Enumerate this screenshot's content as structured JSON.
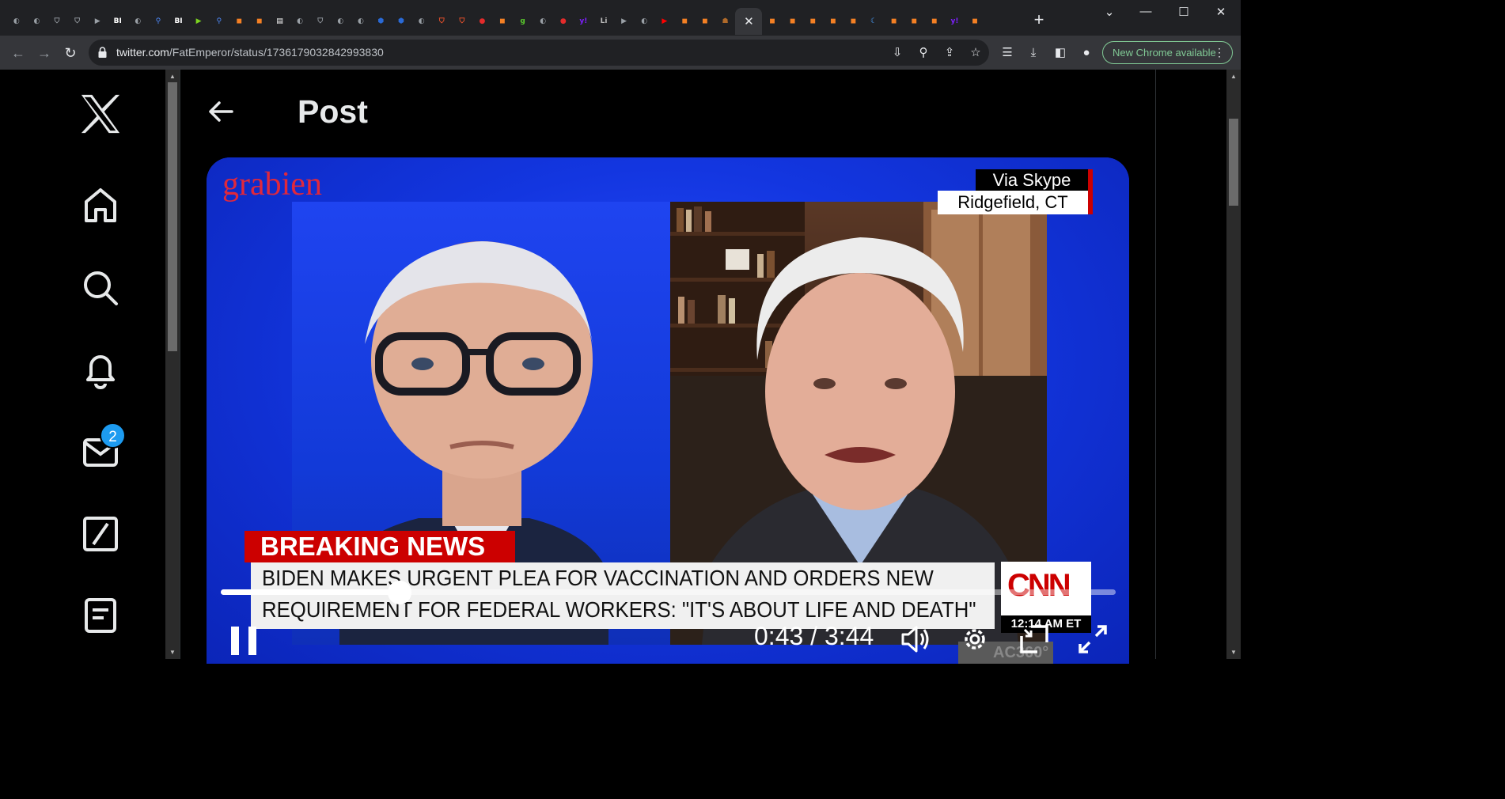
{
  "browser": {
    "tabs": [
      {
        "icon": "globe-icon",
        "glyph": "◐",
        "color": "#9aa0a6"
      },
      {
        "icon": "globe-icon",
        "glyph": "◐",
        "color": "#9aa0a6"
      },
      {
        "icon": "shield-icon",
        "glyph": "⛉",
        "color": "#9aa0a6"
      },
      {
        "icon": "shield-icon",
        "glyph": "⛉",
        "color": "#9aa0a6"
      },
      {
        "icon": "tag-icon",
        "glyph": "▶",
        "color": "#9aa0a6"
      },
      {
        "icon": "bi-icon",
        "glyph": "BI",
        "color": "#ffffff"
      },
      {
        "icon": "globe-icon",
        "glyph": "◐",
        "color": "#9aa0a6"
      },
      {
        "icon": "search-icon",
        "glyph": "⚲",
        "color": "#4f8cff"
      },
      {
        "icon": "bi-icon",
        "glyph": "BI",
        "color": "#ffffff"
      },
      {
        "icon": "play-icon",
        "glyph": "▶",
        "color": "#7cd420"
      },
      {
        "icon": "search-icon",
        "glyph": "⚲",
        "color": "#4f8cff"
      },
      {
        "icon": "bookmark-icon",
        "glyph": "◼",
        "color": "#f48024"
      },
      {
        "icon": "bookmark-icon",
        "glyph": "◼",
        "color": "#f48024"
      },
      {
        "icon": "document-icon",
        "glyph": "▤",
        "color": "#ffffff"
      },
      {
        "icon": "globe-icon",
        "glyph": "◐",
        "color": "#9aa0a6"
      },
      {
        "icon": "shield-icon",
        "glyph": "⛉",
        "color": "#9aa0a6"
      },
      {
        "icon": "globe-icon",
        "glyph": "◐",
        "color": "#9aa0a6"
      },
      {
        "icon": "globe-icon",
        "glyph": "◐",
        "color": "#9aa0a6"
      },
      {
        "icon": "cube-icon",
        "glyph": "⬢",
        "color": "#2a6ad6"
      },
      {
        "icon": "cube-icon",
        "glyph": "⬢",
        "color": "#2a6ad6"
      },
      {
        "icon": "globe-icon",
        "glyph": "◐",
        "color": "#9aa0a6"
      },
      {
        "icon": "brave-icon",
        "glyph": "⛉",
        "color": "#fb542b"
      },
      {
        "icon": "brave-icon",
        "glyph": "⛉",
        "color": "#fb542b"
      },
      {
        "icon": "pin-icon",
        "glyph": "●",
        "color": "#e42b2b"
      },
      {
        "icon": "bookmark-icon",
        "glyph": "◼",
        "color": "#f48024"
      },
      {
        "icon": "g-icon",
        "glyph": "g",
        "color": "#5acb2d"
      },
      {
        "icon": "globe-icon",
        "glyph": "◐",
        "color": "#9aa0a6"
      },
      {
        "icon": "pin-icon",
        "glyph": "●",
        "color": "#e42b2b"
      },
      {
        "icon": "yahoo-icon",
        "glyph": "y!",
        "color": "#7e1fff"
      },
      {
        "icon": "li-icon",
        "glyph": "Li",
        "color": "#bbbbbb"
      },
      {
        "icon": "tag-icon",
        "glyph": "▶",
        "color": "#9aa0a6"
      },
      {
        "icon": "globe-icon",
        "glyph": "◐",
        "color": "#9aa0a6"
      },
      {
        "icon": "youtube-icon",
        "glyph": "▶",
        "color": "#ff0000"
      },
      {
        "icon": "bookmark-icon",
        "glyph": "◼",
        "color": "#f48024"
      },
      {
        "icon": "bookmark-icon",
        "glyph": "◼",
        "color": "#f48024"
      },
      {
        "icon": "portrait-icon",
        "glyph": "☗",
        "color": "#b06a2a"
      },
      {
        "icon": "bookmark-icon",
        "glyph": "◼",
        "color": "#f48024"
      },
      {
        "icon": "bookmark-icon",
        "glyph": "◼",
        "color": "#f48024"
      },
      {
        "icon": "bookmark-icon",
        "glyph": "◼",
        "color": "#f48024"
      },
      {
        "icon": "bookmark-icon",
        "glyph": "◼",
        "color": "#f48024"
      },
      {
        "icon": "bookmark-icon",
        "glyph": "◼",
        "color": "#f48024"
      },
      {
        "icon": "bookmark-icon",
        "glyph": "◼",
        "color": "#f48024"
      },
      {
        "icon": "moon-icon",
        "glyph": "☾",
        "color": "#4aa0ff"
      },
      {
        "icon": "bookmark-icon",
        "glyph": "◼",
        "color": "#f48024"
      },
      {
        "icon": "bookmark-icon",
        "glyph": "◼",
        "color": "#f48024"
      },
      {
        "icon": "bookmark-icon",
        "glyph": "◼",
        "color": "#f48024"
      },
      {
        "icon": "yahoo-icon",
        "glyph": "y!",
        "color": "#7e1fff"
      },
      {
        "icon": "bookmark-icon",
        "glyph": "◼",
        "color": "#f48024"
      }
    ],
    "active_tab_index": 36,
    "url_host": "twitter.com",
    "url_path": "/FatEmperor/status/1736179032842993830",
    "update_label": "New Chrome available"
  },
  "page": {
    "title": "Post",
    "messages_badge": "2"
  },
  "video": {
    "watermark": "grabien",
    "via_label": "Via Skype",
    "location_label": "Ridgefield, CT",
    "breaking_label": "BREAKING NEWS",
    "headline_line1": "BIDEN MAKES URGENT PLEA FOR VACCINATION AND ORDERS NEW",
    "headline_line2": "REQUIREMENT FOR FEDERAL WORKERS: \"IT'S ABOUT LIFE AND DEATH\"",
    "network_logo": "CNN",
    "network_time": "12:14 AM ET",
    "partial_ticker": "AC360°",
    "time_display": "0:43 / 3:44",
    "progress_fraction": 0.2
  }
}
